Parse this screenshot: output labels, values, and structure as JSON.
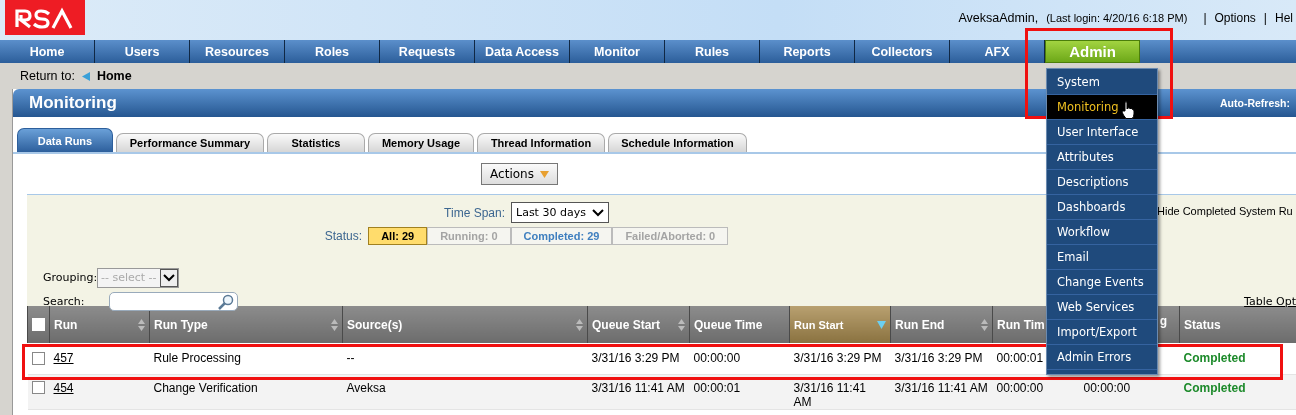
{
  "header": {
    "user": "AveksaAdmin,",
    "last_login": "(Last login: 4/20/16 6:18 PM)",
    "separator": "|",
    "links": [
      "Options",
      "Hel"
    ]
  },
  "nav": [
    {
      "label": "Home",
      "selected": false
    },
    {
      "label": "Users",
      "selected": false
    },
    {
      "label": "Resources",
      "selected": false
    },
    {
      "label": "Roles",
      "selected": false
    },
    {
      "label": "Requests",
      "selected": false
    },
    {
      "label": "Data Access",
      "selected": false
    },
    {
      "label": "Monitor",
      "selected": false
    },
    {
      "label": "Rules",
      "selected": false
    },
    {
      "label": "Reports",
      "selected": false
    },
    {
      "label": "Collectors",
      "selected": false
    },
    {
      "label": "AFX",
      "selected": false
    },
    {
      "label": "Admin",
      "selected": true,
      "highlighted": true
    }
  ],
  "breadcrumb": {
    "label": "Return to:",
    "link": "Home"
  },
  "panel": {
    "title": "Monitoring",
    "auto_refresh": "Auto-Refresh:"
  },
  "tabs": [
    {
      "label": "Data Runs",
      "selected": true
    },
    {
      "label": "Performance Summary",
      "selected": false
    },
    {
      "label": "Statistics",
      "selected": false
    },
    {
      "label": "Memory Usage",
      "selected": false
    },
    {
      "label": "Thread Information",
      "selected": false
    },
    {
      "label": "Schedule Information",
      "selected": false
    }
  ],
  "actions_button": "Actions",
  "filters": {
    "time_span_label": "Time Span:",
    "time_span": "Last 30 days",
    "status_label": "Status:",
    "status": [
      {
        "label": "All: 29",
        "selected": true,
        "kind": "active"
      },
      {
        "label": "Running: 0",
        "selected": false,
        "kind": "empty"
      },
      {
        "label": "Completed: 29",
        "selected": false,
        "kind": "count"
      },
      {
        "label": "Failed/Aborted: 0",
        "selected": false,
        "kind": "empty"
      }
    ],
    "hide_label": "Hide Completed System Ru",
    "grouping_label": "Grouping:",
    "grouping_placeholder": "-- select --",
    "search_label": "Search:",
    "table_options": "Table Opt"
  },
  "table": {
    "select_all": {
      "checked": false
    },
    "columns": [
      {
        "label": "Run",
        "sortable": true,
        "sorted": false
      },
      {
        "label": "Run Type",
        "sortable": true,
        "sorted": false
      },
      {
        "label": "Source(s)",
        "sortable": true,
        "sorted": false
      },
      {
        "label": "Queue Start",
        "sortable": true,
        "sorted": false
      },
      {
        "label": "Queue Time",
        "sortable": false,
        "sorted": false
      },
      {
        "label": "Run Start",
        "sorted": true
      },
      {
        "label": "Run End",
        "sortable": true,
        "sorted": false
      },
      {
        "label": "Run Tim",
        "sorted": false
      },
      {
        "label": "g",
        "sorted": false
      },
      {
        "label": "Status",
        "sorted": false
      }
    ],
    "rows": [
      {
        "checked": false,
        "highlighted": true,
        "cells": [
          "457",
          "Rule Processing",
          "--",
          "3/31/16 3:29 PM",
          "00:00:00",
          "3/31/16 3:29 PM",
          "3/31/16 3:29 PM",
          "00:00:01",
          "",
          "Completed"
        ]
      },
      {
        "checked": false,
        "highlighted": false,
        "cells": [
          "454",
          "Change Verification",
          "Aveksa",
          "3/31/16 11:41 AM",
          "00:00:01",
          "3/31/16 11:41 AM",
          "3/31/16 11:41 AM",
          "00:00:00",
          "00:00:00",
          "Completed"
        ]
      }
    ]
  },
  "admin_menu": [
    {
      "label": "System",
      "selected": false
    },
    {
      "label": "Monitoring",
      "selected": true
    },
    {
      "label": "User Interface",
      "selected": false
    },
    {
      "label": "Attributes",
      "selected": false
    },
    {
      "label": "Descriptions",
      "selected": false
    },
    {
      "label": "Dashboards",
      "selected": false
    },
    {
      "label": "Workflow",
      "selected": false
    },
    {
      "label": "Email",
      "selected": false
    },
    {
      "label": "Change Events",
      "selected": false
    },
    {
      "label": "Web Services",
      "selected": false
    },
    {
      "label": "Import/Export",
      "selected": false
    },
    {
      "label": "Admin Errors",
      "selected": false
    }
  ]
}
